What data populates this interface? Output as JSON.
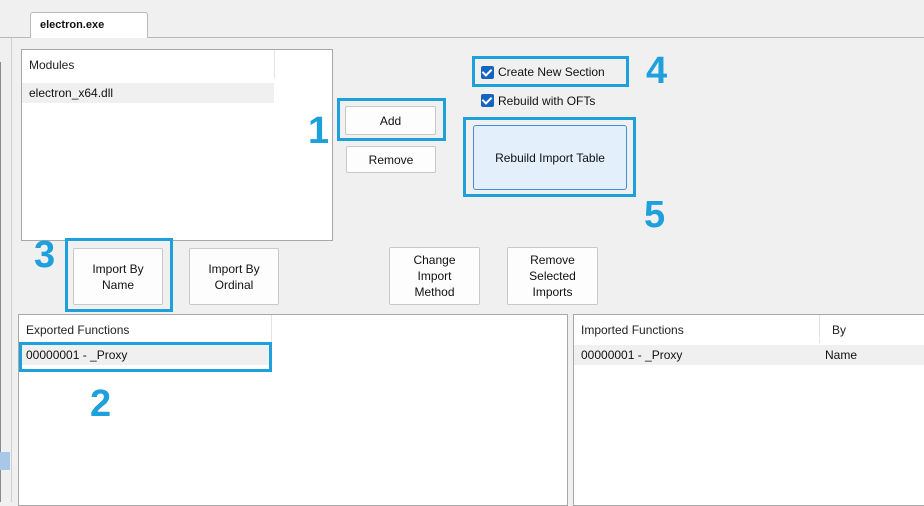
{
  "tab": {
    "title": "electron.exe"
  },
  "modules": {
    "header": "Modules",
    "items": [
      "electron_x64.dll"
    ]
  },
  "buttons": {
    "add": "Add",
    "remove": "Remove",
    "rebuild_import_table": "Rebuild Import Table",
    "import_by_name": "Import By\nName",
    "import_by_ordinal": "Import By\nOrdinal",
    "change_import_method": "Change\nImport\nMethod",
    "remove_selected_imports": "Remove\nSelected\nImports"
  },
  "options": {
    "create_new_section": {
      "label": "Create New Section",
      "checked": true
    },
    "rebuild_with_ofts": {
      "label": "Rebuild with OFTs",
      "checked": true
    }
  },
  "exported": {
    "header": "Exported Functions",
    "rows": [
      "00000001 - _Proxy"
    ]
  },
  "imported": {
    "headers": [
      "Imported Functions",
      "By"
    ],
    "rows": [
      [
        "00000001 - _Proxy",
        "Name"
      ]
    ]
  },
  "annotations": [
    "1",
    "2",
    "3",
    "4",
    "5"
  ],
  "colors": {
    "annotation": "#1ea0dc",
    "checkbox": "#1565c0",
    "primary_button_border": "#3d8ee2",
    "primary_button_fill": "#e3effa"
  }
}
